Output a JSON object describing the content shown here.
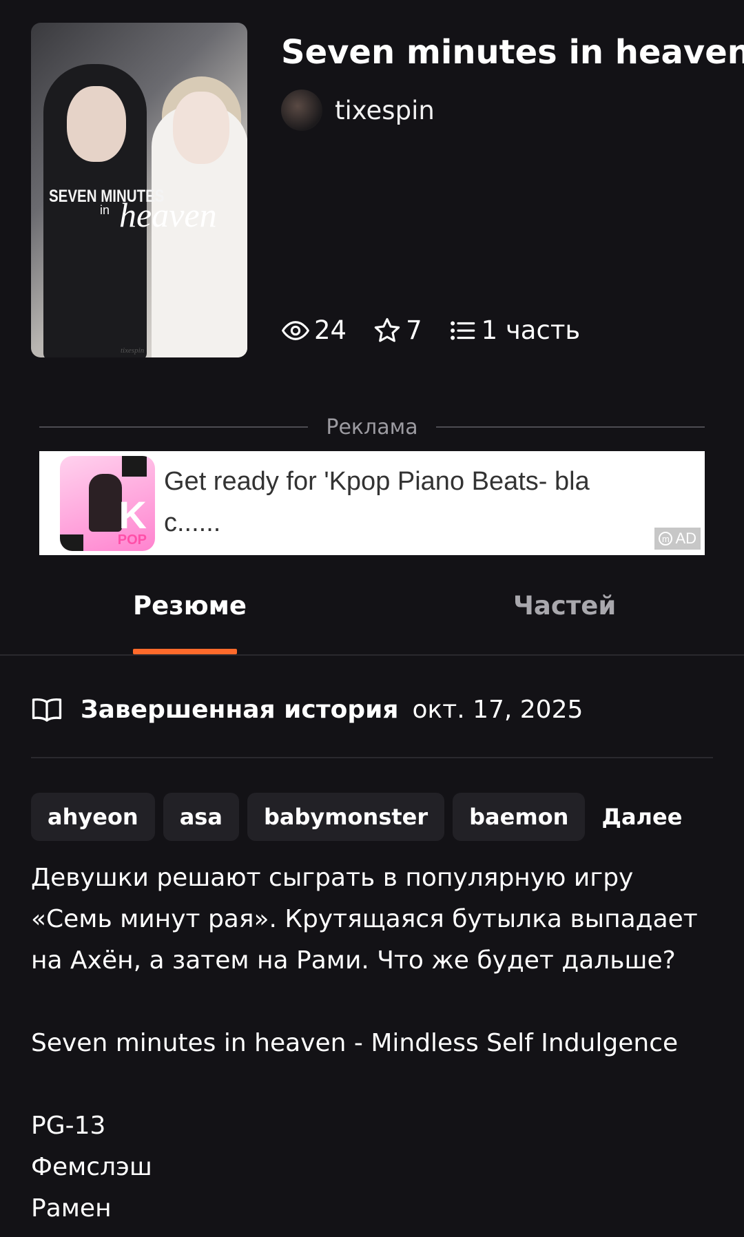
{
  "story": {
    "title": "Seven minutes in heaven",
    "author": "tixespin",
    "cover": {
      "title_line1": "SEVEN MINUTES",
      "title_line2": "in",
      "title_line3": "heaven",
      "signature": "tixespin"
    },
    "stats": {
      "views": "24",
      "votes": "7",
      "parts": "1 часть"
    }
  },
  "ad": {
    "label": "Реклама",
    "text": "Get ready for 'Kpop Piano Beats- bla c......",
    "badge": "AD",
    "icon_text": "K",
    "icon_subtext": "POP"
  },
  "tabs": [
    {
      "label": "Резюме",
      "active": true
    },
    {
      "label": "Частей",
      "active": false
    }
  ],
  "status": {
    "label": "Завершенная история",
    "date": "окт. 17, 2025"
  },
  "tags": [
    "ahyeon",
    "asa",
    "babymonster",
    "baemon"
  ],
  "more_label": "Далее",
  "description": {
    "paragraph1": "Девушки решают сыграть в популярную игру «Семь минут рая». Крутящаяся бутылка выпадает на Ахён, а затем на Рами. Что же будет дальше?",
    "paragraph2": "Seven minutes in heaven - Mindless Self Indulgence",
    "line1": "PG-13",
    "line2": "Фемслэш",
    "line3": "Рамен"
  },
  "colors": {
    "background": "#131216",
    "accent": "#ff6a2b",
    "tag_background": "#222126",
    "muted_text": "#a9a8ad"
  }
}
